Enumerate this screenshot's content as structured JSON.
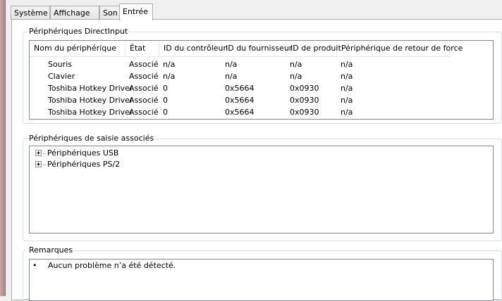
{
  "tabs": [
    {
      "label": "Système"
    },
    {
      "label": "Affichage"
    },
    {
      "label": "Son"
    },
    {
      "label": "Entrée"
    }
  ],
  "directinput": {
    "title": "Périphériques DirectInput",
    "columns": [
      "Nom du périphérique",
      "État",
      "ID du contrôleur",
      "ID du fournisseur",
      "ID de produit",
      "Périphérique de retour de force"
    ],
    "rows": [
      [
        "Souris",
        "Associé",
        "n/a",
        "n/a",
        "n/a",
        "n/a"
      ],
      [
        "Clavier",
        "Associé",
        "n/a",
        "n/a",
        "n/a",
        "n/a"
      ],
      [
        "Toshiba Hotkey Driver",
        "Associé",
        "0",
        "0x5664",
        "0x0930",
        "n/a"
      ],
      [
        "Toshiba Hotkey Driver",
        "Associé",
        "0",
        "0x5664",
        "0x0930",
        "n/a"
      ],
      [
        "Toshiba Hotkey Driver",
        "Associé",
        "0",
        "0x5664",
        "0x0930",
        "n/a"
      ]
    ]
  },
  "input_devices": {
    "title": "Périphériques de saisie associés",
    "items": [
      {
        "label": "Périphériques USB"
      },
      {
        "label": "Périphériques PS/2"
      }
    ]
  },
  "notes": {
    "title": "Remarques",
    "bullet": "•",
    "items": [
      "Aucun problème n’a été détecté."
    ]
  }
}
